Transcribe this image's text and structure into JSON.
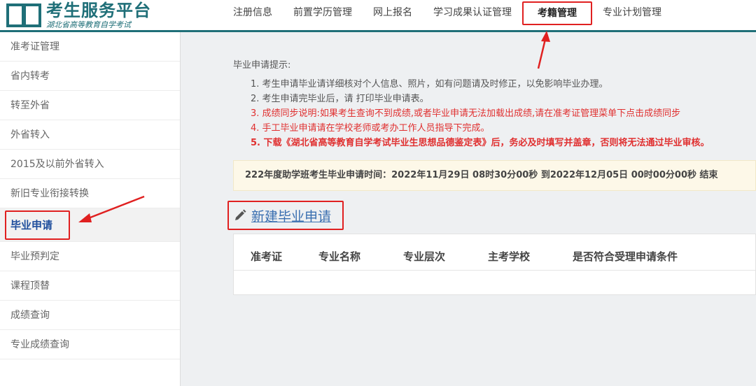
{
  "header": {
    "title": "考生服务平台",
    "subtitle": "湖北省高等教育自学考试",
    "nav": [
      {
        "label": "注册信息"
      },
      {
        "label": "前置学历管理"
      },
      {
        "label": "网上报名"
      },
      {
        "label": "学习成果认证管理"
      },
      {
        "label": "考籍管理",
        "active": true
      },
      {
        "label": "专业计划管理"
      }
    ]
  },
  "sidebar": {
    "items": [
      {
        "label": "准考证管理"
      },
      {
        "label": "省内转考"
      },
      {
        "label": "转至外省"
      },
      {
        "label": "外省转入"
      },
      {
        "label": "2015及以前外省转入"
      },
      {
        "label": "新旧专业衔接转换"
      },
      {
        "label": "毕业申请",
        "active": true
      },
      {
        "label": "毕业预判定"
      },
      {
        "label": "课程顶替"
      },
      {
        "label": "成绩查询"
      },
      {
        "label": "专业成绩查询"
      }
    ]
  },
  "main": {
    "tips_title": "毕业申请提示:",
    "tips": [
      "1. 考生申请毕业请详细核对个人信息、照片，如有问题请及时修正，以免影响毕业办理。",
      "2. 考生申请完毕业后，请 打印毕业申请表。",
      "3. 成绩同步说明:如果考生查询不到成绩,或者毕业申请无法加载出成绩,请在准考证管理菜单下点击成绩同步",
      "4. 手工毕业申请请在学校老师或考办工作人员指导下完成。",
      "5. 下载《湖北省高等教育自学考试毕业生思想品德鉴定表》后，务必及时填写并盖章，否则将无法通过毕业审核。"
    ],
    "notice": "222年度助学班考生毕业申请时间：2022年11月29日 08时30分00秒 到2022年12月05日 00时00分00秒 结束",
    "new_link": "新建毕业申请",
    "table_headers": [
      "准考证",
      "专业名称",
      "专业层次",
      "主考学校",
      "是否符合受理申请条件"
    ]
  },
  "colors": {
    "brand": "#1f6f78",
    "annotation": "#e02020",
    "warning_text": "#e03030",
    "link": "#3a6fb0"
  }
}
